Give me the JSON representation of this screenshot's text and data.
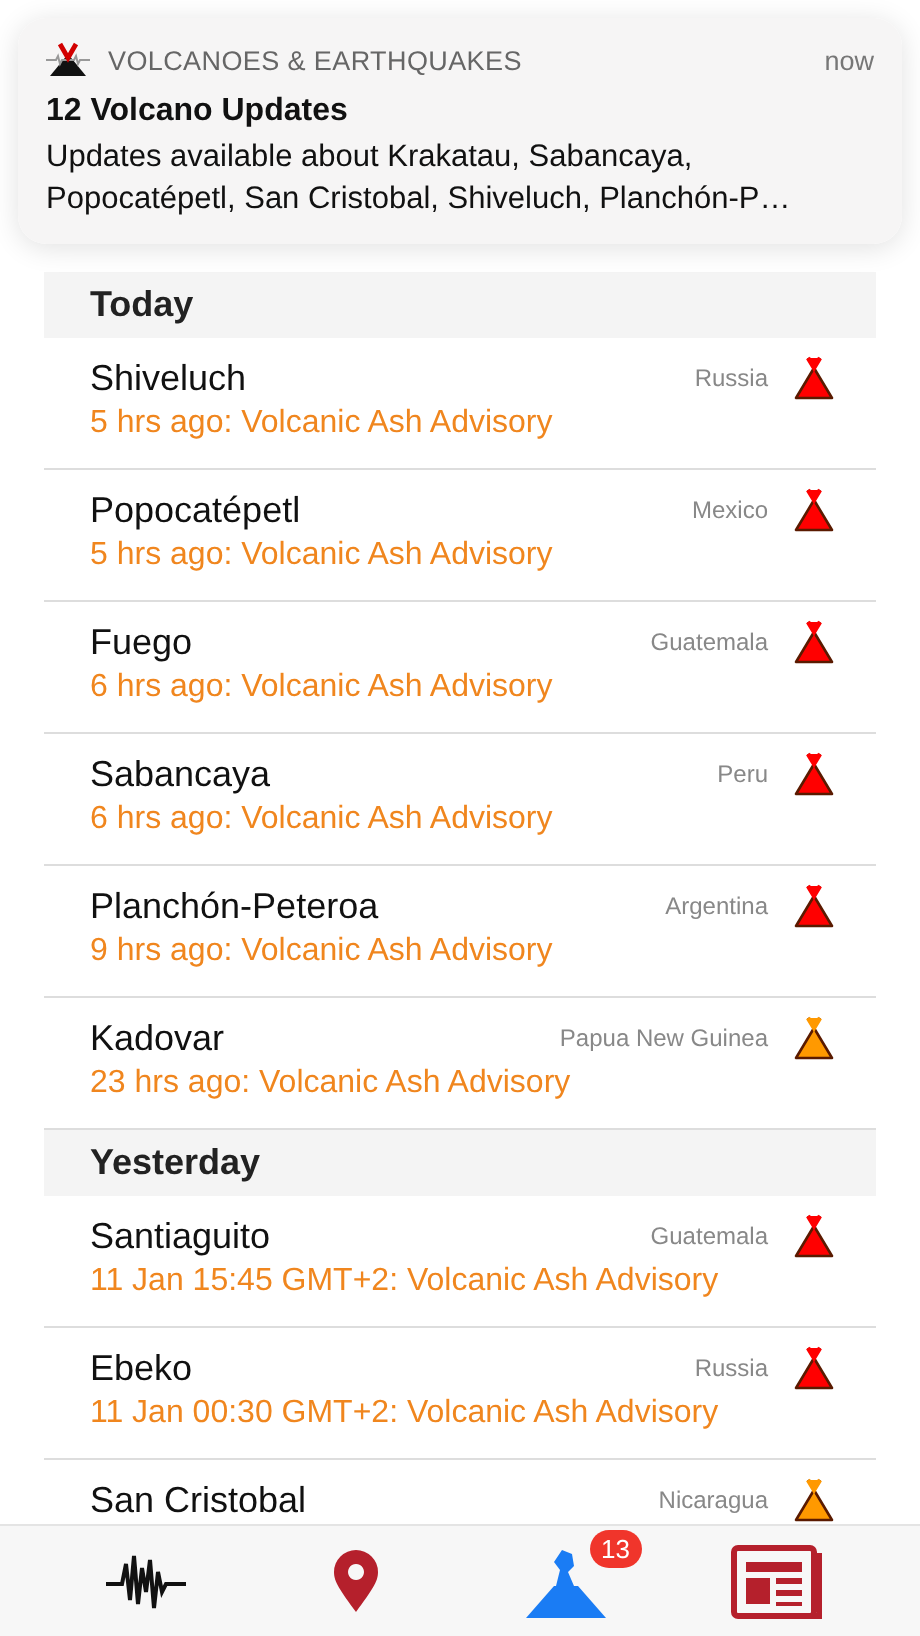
{
  "notification": {
    "app_name": "VOLCANOES & EARTHQUAKES",
    "time": "now",
    "title": "12 Volcano Updates",
    "body": "Updates available about Krakatau, Sabancaya, Popocatépetl, San Cristobal, Shiveluch, Planchón-P…"
  },
  "sections": [
    {
      "title": "Today",
      "items": [
        {
          "name": "Shiveluch",
          "country": "Russia",
          "update": "5 hrs ago: Volcanic Ash Advisory",
          "color": "#ff0000"
        },
        {
          "name": "Popocatépetl",
          "country": "Mexico",
          "update": "5 hrs ago: Volcanic Ash Advisory",
          "color": "#ff0000"
        },
        {
          "name": "Fuego",
          "country": "Guatemala",
          "update": "6 hrs ago: Volcanic Ash Advisory",
          "color": "#ff0000"
        },
        {
          "name": "Sabancaya",
          "country": "Peru",
          "update": "6 hrs ago: Volcanic Ash Advisory",
          "color": "#ff0000"
        },
        {
          "name": "Planchón-Peteroa",
          "country": "Argentina",
          "update": "9 hrs ago: Volcanic Ash Advisory",
          "color": "#ff0000"
        },
        {
          "name": "Kadovar",
          "country": "Papua New Guinea",
          "update": "23 hrs ago: Volcanic Ash Advisory",
          "color": "#ff9900"
        }
      ]
    },
    {
      "title": "Yesterday",
      "items": [
        {
          "name": "Santiaguito",
          "country": "Guatemala",
          "update": "11 Jan 15:45 GMT+2: Volcanic Ash Advisory",
          "color": "#ff0000"
        },
        {
          "name": "Ebeko",
          "country": "Russia",
          "update": "11 Jan 00:30 GMT+2: Volcanic Ash Advisory",
          "color": "#ff0000"
        },
        {
          "name": "San Cristobal",
          "country": "Nicaragua",
          "color": "#ff9900"
        }
      ]
    }
  ],
  "tab_bar": [
    {
      "kind": "seismogram",
      "selected": false
    },
    {
      "kind": "map",
      "selected": false
    },
    {
      "kind": "volcano",
      "selected": true,
      "badge": "13"
    },
    {
      "kind": "news",
      "selected": false
    }
  ]
}
